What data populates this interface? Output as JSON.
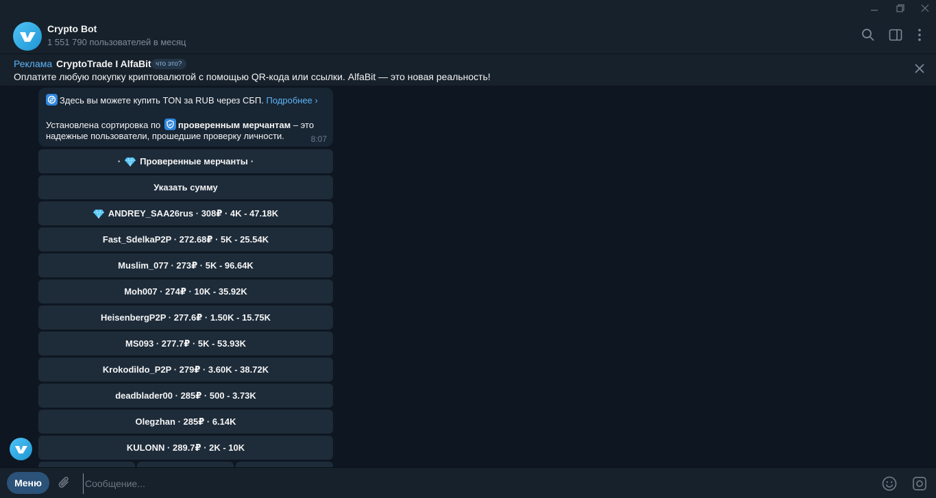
{
  "window": {
    "controls": [
      "minimize-icon",
      "restore-icon",
      "close-icon"
    ]
  },
  "header": {
    "title": "Crypto Bot",
    "subtitle": "1 551 790 пользователей в месяц",
    "icons": [
      "search-icon",
      "sidebar-toggle-icon",
      "more-vertical-icon"
    ]
  },
  "ad": {
    "label": "Реклама",
    "name": "CryptoTrade I AlfaBit",
    "what_badge": "что это?",
    "text": "Оплатите любую покупку криптовалютой с помощью QR-кода или ссылки. AlfaBit — это новая реальность!"
  },
  "message": {
    "line1_text": "Здесь вы можете купить TON за RUB через СБП.",
    "line1_link": "Подробнее ›",
    "line2_prefix": "Установлена сортировка по",
    "line2_bold": "проверенным мерчантам",
    "line2_suffix": "– это",
    "line3": "надежные пользователи, прошедшие проверку личности.",
    "time": "8:07"
  },
  "keyboard": {
    "verified_left": "·",
    "verified_label": "Проверенные мерчанты",
    "verified_right": "·",
    "amount": "Указать сумму",
    "merchants": [
      "ANDREY_SAA26rus · 308₽ · 4K - 47.18K",
      "Fast_SdelkaP2P · 272.68₽ · 5K - 25.54K",
      "Muslim_077 · 273₽ · 5K - 96.64K",
      "Moh007 · 274₽ · 10K - 35.92K",
      "HeisenbergP2P · 277.6₽ · 1.50K - 15.75K",
      "MS093 · 277.7₽ · 5K - 53.93K",
      "Krokodildo_P2P · 279₽ · 3.60K - 38.72K",
      "deadblader00 · 285₽ · 500 - 3.73K",
      "Olegzhan · 285₽ · 6.14K",
      "KULONN · 289.7₽ · 2K - 10K"
    ]
  },
  "input_bar": {
    "menu_label": "Меню",
    "placeholder": "Сообщение...",
    "icons": [
      "attach-icon",
      "emoji-icon",
      "bot-commands-icon"
    ]
  },
  "colors": {
    "background": "#0e1621",
    "panel": "#17212b",
    "bubble": "#182533",
    "button": "#1e2c3a",
    "link": "#5eb5f7",
    "menu_button": "#2b5278"
  }
}
